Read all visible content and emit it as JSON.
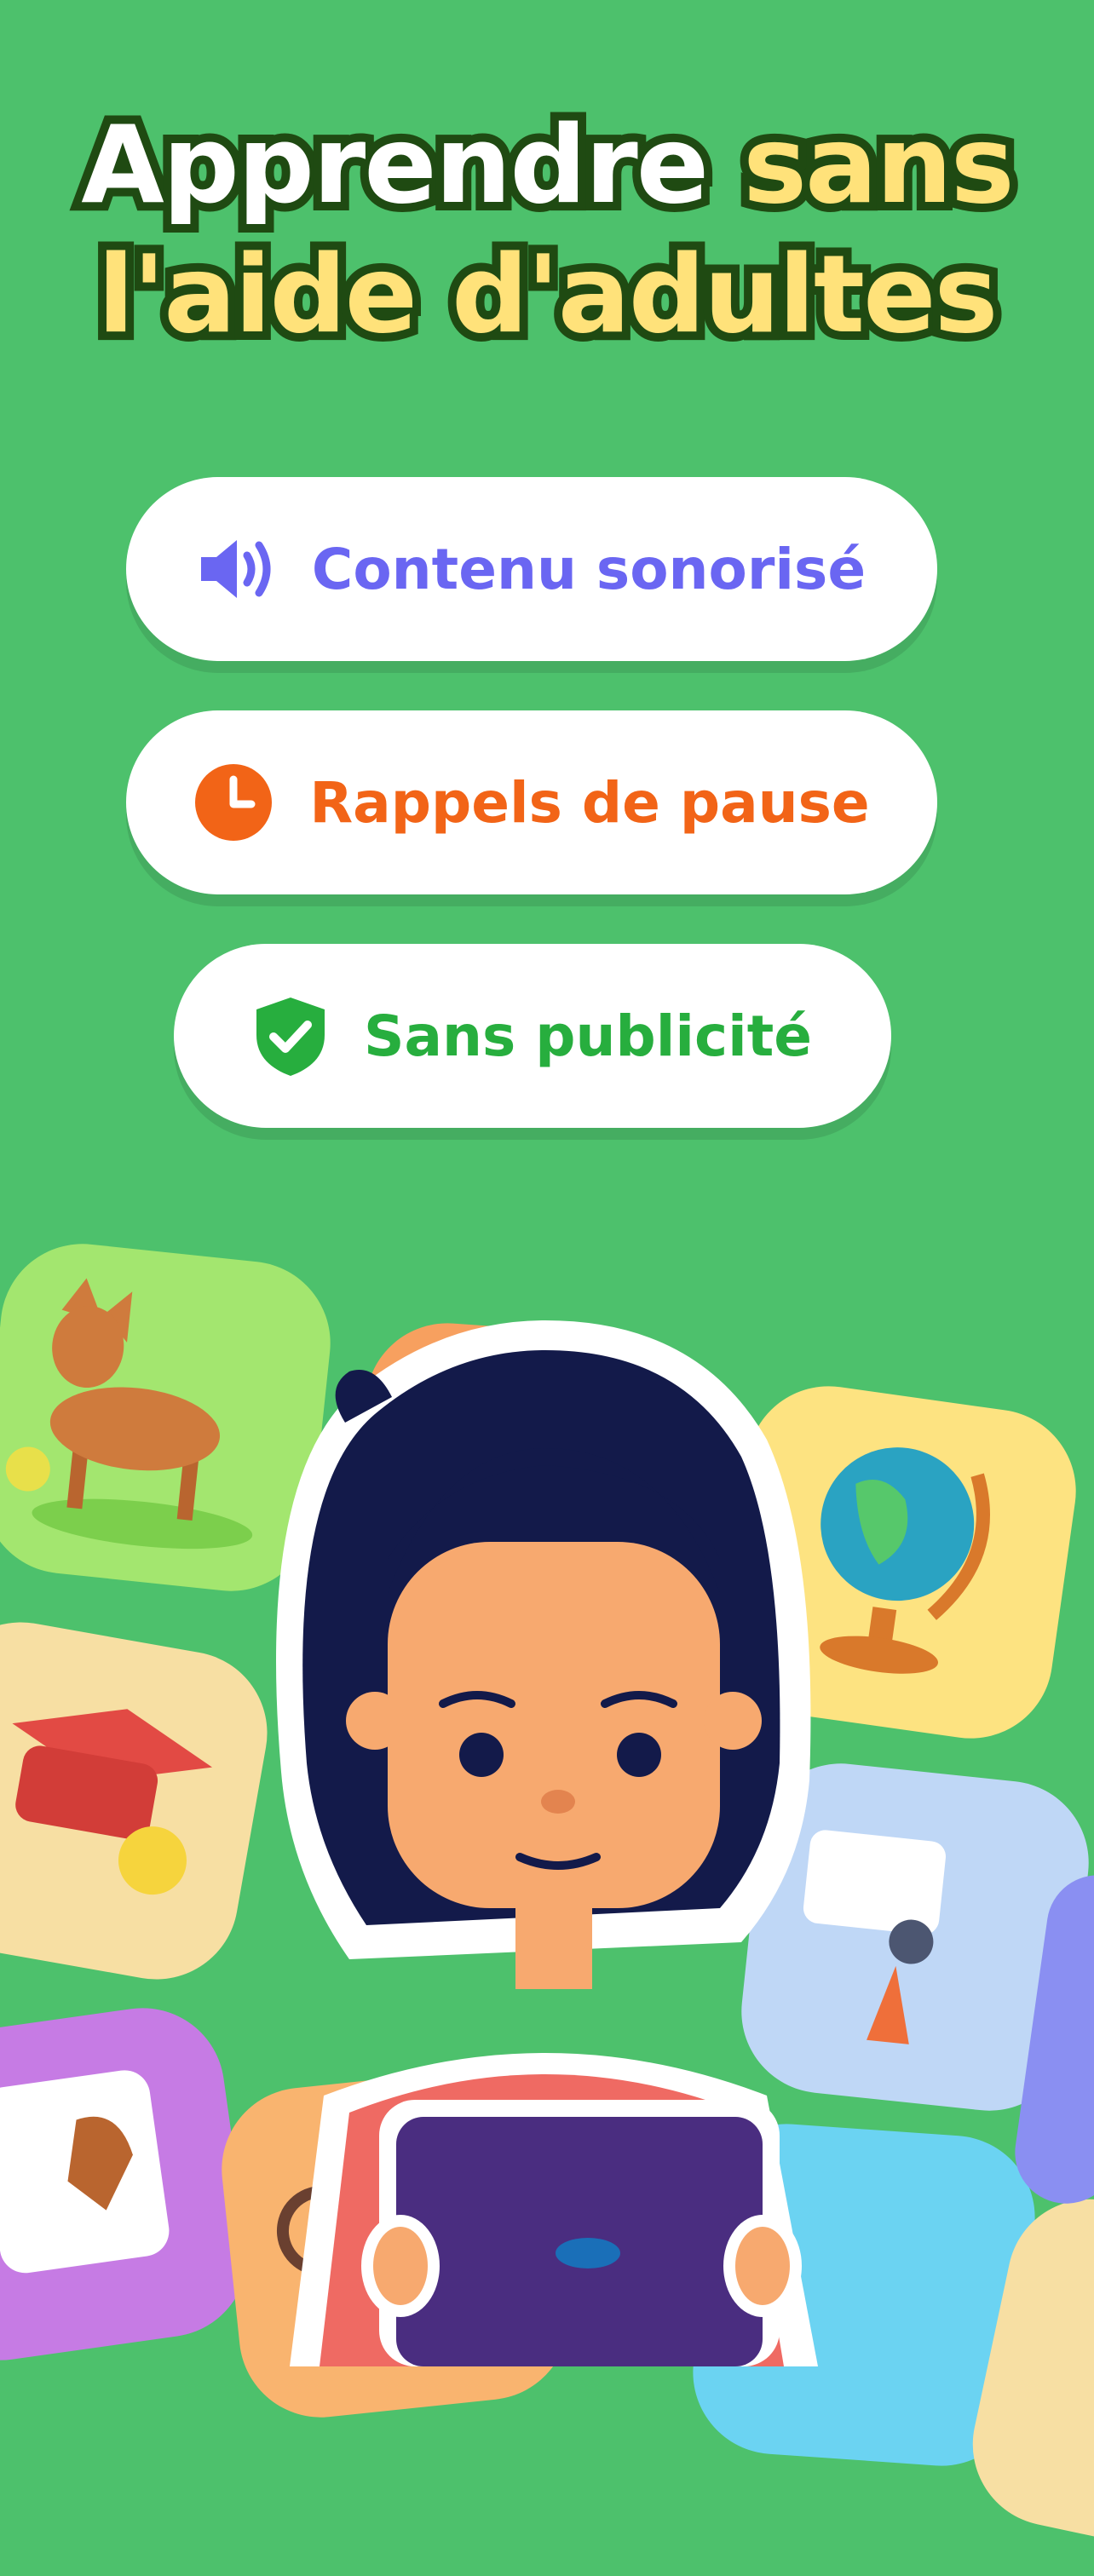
{
  "headline": {
    "line1_white": "Apprendre",
    "line1_yellow": "sans",
    "line2_yellow": "l'aide d'adultes"
  },
  "features": [
    {
      "label": "Contenu sonorisé",
      "icon": "speaker-icon",
      "color": "#6a66f2"
    },
    {
      "label": "Rappels de pause",
      "icon": "clock-icon",
      "color": "#f26417"
    },
    {
      "label": "Sans publicité",
      "icon": "shield-check-icon",
      "color": "#27ae3e"
    }
  ],
  "colors": {
    "background": "#4dc16c",
    "headline_white": "#ffffff",
    "headline_yellow": "#ffe27a",
    "headline_outline": "#1f4a12"
  }
}
